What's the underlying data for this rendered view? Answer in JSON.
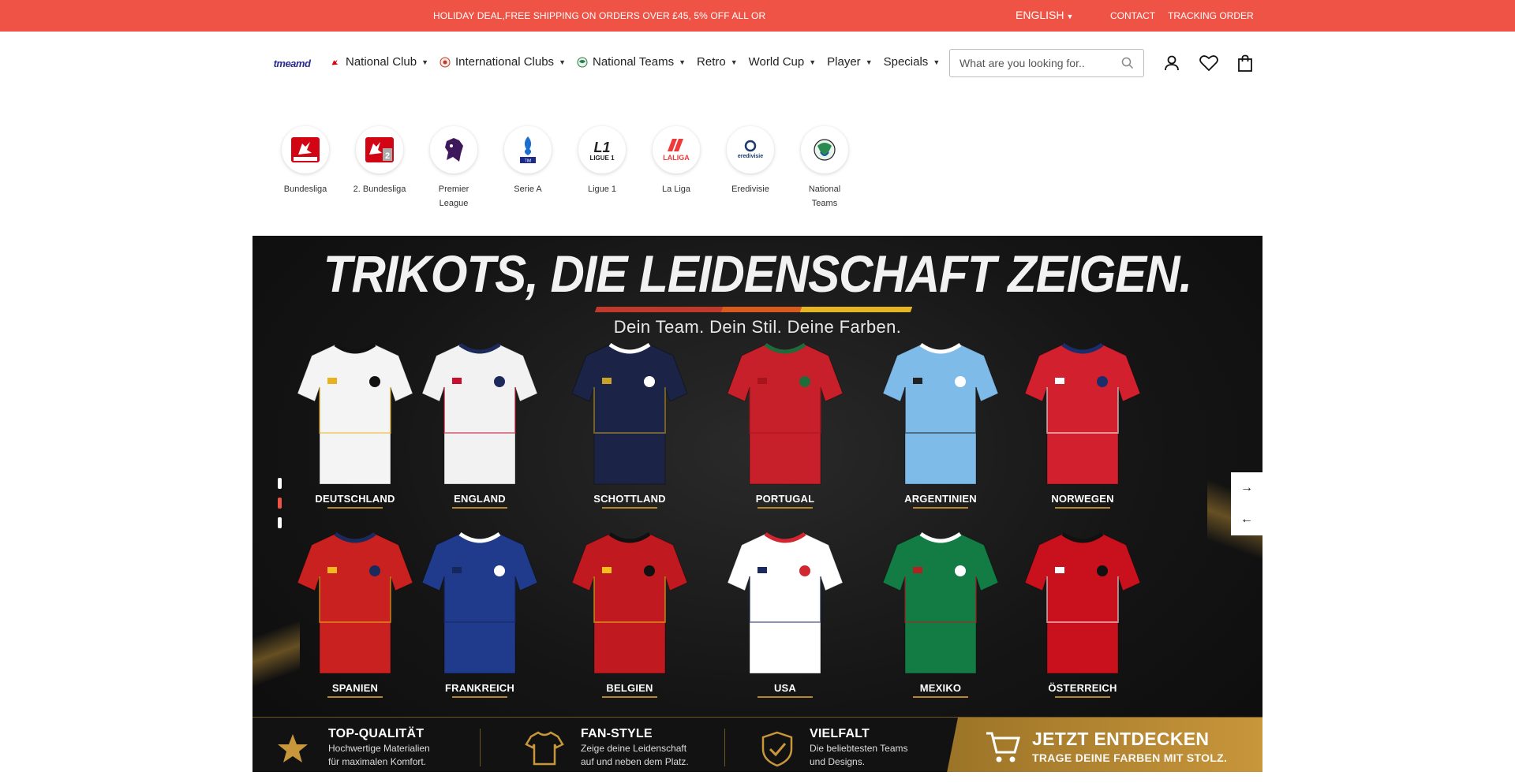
{
  "topbar": {
    "promo": "HOLIDAY DEAL,FREE SHIPPING ON ORDERS OVER £45, 5% OFF ALL OR",
    "language": "ENGLISH",
    "contact": "CONTACT",
    "tracking": "TRACKING ORDER",
    "bg_color": "#ef5345"
  },
  "header": {
    "logo_text": "tmeamd",
    "nav": [
      {
        "label": "National Club",
        "icon": "bundesliga-icon"
      },
      {
        "label": "International Clubs",
        "icon": "globe-club-icon"
      },
      {
        "label": "National Teams",
        "icon": "world-ball-icon"
      },
      {
        "label": "Retro"
      },
      {
        "label": "World Cup"
      },
      {
        "label": "Player"
      },
      {
        "label": "Specials"
      }
    ],
    "search_placeholder": "What are you looking for.."
  },
  "categories": [
    {
      "label": "Bundesliga",
      "icon": "bundesliga-logo-icon"
    },
    {
      "label": "2. Bundesliga",
      "icon": "bundesliga-2-logo-icon"
    },
    {
      "label": "Premier League",
      "icon": "premier-league-lion-icon"
    },
    {
      "label": "Serie A",
      "icon": "serie-a-logo-icon"
    },
    {
      "label": "Ligue 1",
      "icon": "ligue-1-logo-icon"
    },
    {
      "label": "La Liga",
      "icon": "laliga-logo-icon"
    },
    {
      "label": "Eredivisie",
      "icon": "eredivisie-logo-icon"
    },
    {
      "label": "National Teams",
      "icon": "national-teams-ball-icon"
    }
  ],
  "banner": {
    "headline": "TRIKOTS, DIE LEIDENSCHAFT ZEIGEN.",
    "subline": "Dein Team. Dein Stil. Deine Farben.",
    "countries": [
      {
        "name": "DEUTSCHLAND",
        "main": "#f4f4f4",
        "accent": "#111111",
        "accent2": "#e8b21e"
      },
      {
        "name": "ENGLAND",
        "main": "#f2f2f2",
        "accent": "#1c2a5a",
        "accent2": "#c8102e"
      },
      {
        "name": "SCHOTTLAND",
        "main": "#1b2446",
        "accent": "#ffffff",
        "accent2": "#c9a227"
      },
      {
        "name": "PORTUGAL",
        "main": "#c8202a",
        "accent": "#1f6b3a",
        "accent2": "#a8141c"
      },
      {
        "name": "ARGENTINIEN",
        "main": "#7fbbe8",
        "accent": "#ffffff",
        "accent2": "#222222"
      },
      {
        "name": "NORWEGEN",
        "main": "#d3202e",
        "accent": "#1b2d6b",
        "accent2": "#ffffff"
      },
      {
        "name": "SPANIEN",
        "main": "#c8211f",
        "accent": "#1b2a5c",
        "accent2": "#f1b81f"
      },
      {
        "name": "FRANKREICH",
        "main": "#213b8c",
        "accent": "#ffffff",
        "accent2": "#16265e"
      },
      {
        "name": "BELGIEN",
        "main": "#c01920",
        "accent": "#111111",
        "accent2": "#f1c11a"
      },
      {
        "name": "USA",
        "main": "#ffffff",
        "accent": "#d22630",
        "accent2": "#1b2a5c"
      },
      {
        "name": "MEXIKO",
        "main": "#137c45",
        "accent": "#ffffff",
        "accent2": "#b22222"
      },
      {
        "name": "ÖSTERREICH",
        "main": "#c8111c",
        "accent": "#111111",
        "accent2": "#ffffff"
      }
    ],
    "features": [
      {
        "title": "TOP-QUALITÄT",
        "desc1": "Hochwertige Materialien",
        "desc2": "für maximalen Komfort.",
        "icon": "star-icon"
      },
      {
        "title": "FAN-STYLE",
        "desc1": "Zeige deine Leidenschaft",
        "desc2": "auf und neben dem Platz.",
        "icon": "shirt-icon"
      },
      {
        "title": "VIELFALT",
        "desc1": "Die beliebtesten Teams",
        "desc2": "und Designs.",
        "icon": "shield-check-icon"
      }
    ],
    "cta_title": "JETZT ENTDECKEN",
    "cta_sub": "TRAGE DEINE FARBEN MIT STOLZ.",
    "slide_count": 3,
    "active_slide": 2
  }
}
